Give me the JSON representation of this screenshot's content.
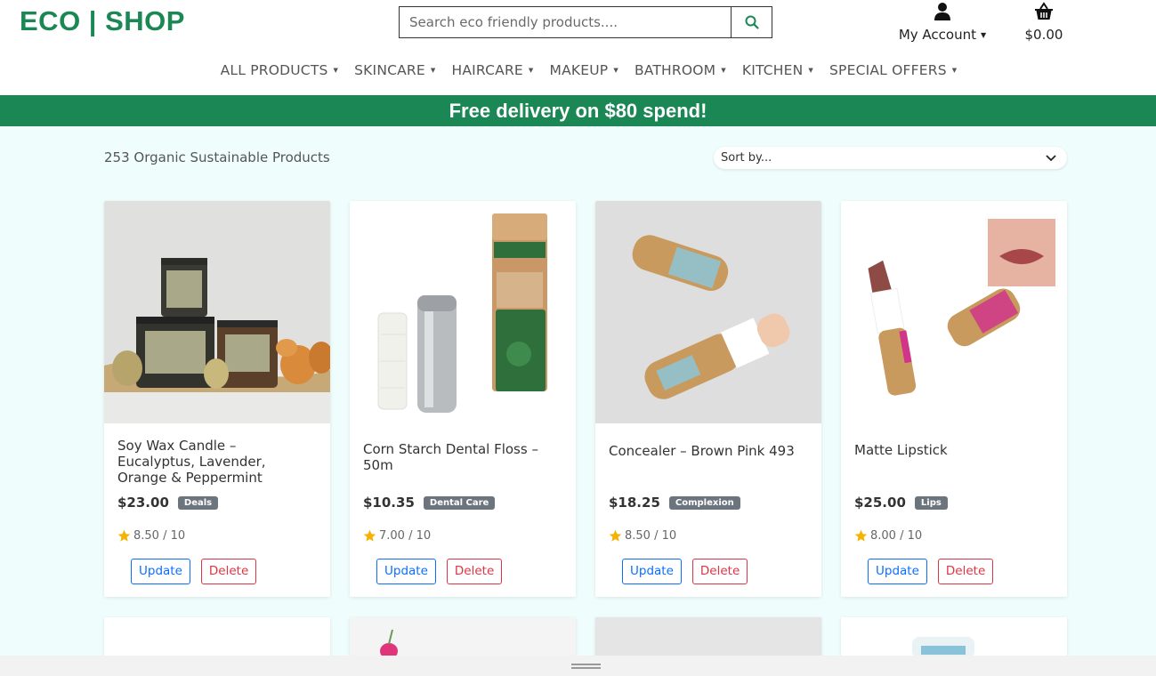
{
  "header": {
    "logo": "ECO | SHOP",
    "search_placeholder": "Search eco friendly products....",
    "account_label": "My Account",
    "cart_total": "$0.00"
  },
  "nav": [
    {
      "label": "ALL PRODUCTS"
    },
    {
      "label": "SKINCARE"
    },
    {
      "label": "HAIRCARE"
    },
    {
      "label": "MAKEUP"
    },
    {
      "label": "BATHROOM"
    },
    {
      "label": "KITCHEN"
    },
    {
      "label": "SPECIAL OFFERS"
    }
  ],
  "banner": "Free delivery on $80 spend!",
  "products_count": "253 Organic Sustainable Products",
  "sort_placeholder": "Sort by...",
  "products": [
    {
      "name": "Soy Wax Candle – Eucalyptus, Lavender, Orange & Peppermint",
      "price": "$23.00",
      "category": "Deals",
      "rating": "8.50 / 10",
      "update": "Update",
      "delete": "Delete"
    },
    {
      "name": "Corn Starch Dental Floss – 50m",
      "price": "$10.35",
      "category": "Dental Care",
      "rating": "7.00 / 10",
      "update": "Update",
      "delete": "Delete"
    },
    {
      "name": "Concealer – Brown Pink 493",
      "price": "$18.25",
      "category": "Complexion",
      "rating": "8.50 / 10",
      "update": "Update",
      "delete": "Delete"
    },
    {
      "name": "Matte Lipstick",
      "price": "$25.00",
      "category": "Lips",
      "rating": "8.00 / 10",
      "update": "Update",
      "delete": "Delete"
    }
  ],
  "colors": {
    "brand": "#1a8754",
    "page_bg": "#effefd",
    "badge": "#6c757d",
    "update": "#0d6efd",
    "delete": "#dc3545",
    "star": "#f5b301"
  }
}
